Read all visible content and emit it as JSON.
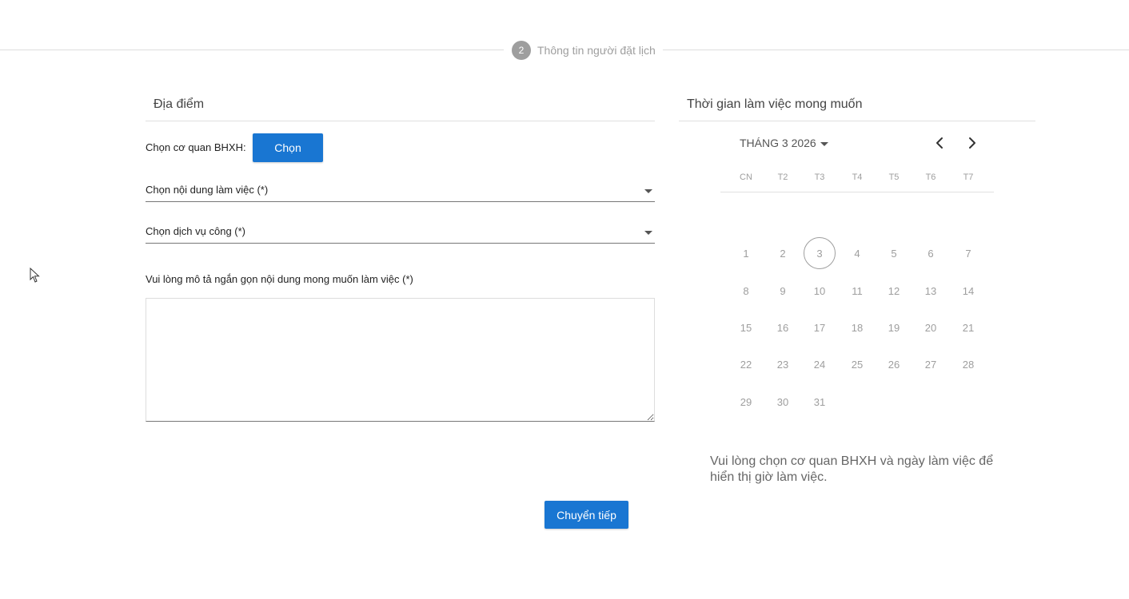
{
  "stepper": {
    "step_number": "2",
    "step_label": "Thông tin người đặt lịch"
  },
  "location": {
    "title": "Địa điểm",
    "agency_label": "Chọn cơ quan BHXH:",
    "choose_button": "Chọn",
    "work_content_select": "Chọn nội dung làm việc (*)",
    "public_service_select": "Chọn dịch vụ công (*)",
    "description_label": "Vui lòng mô tả ngắn gọn nội dung mong muốn làm việc (*)",
    "description_value": ""
  },
  "schedule": {
    "title": "Thời gian làm việc mong muốn",
    "month_label": "THÁNG 3 2026",
    "weekdays": [
      "CN",
      "T2",
      "T3",
      "T4",
      "T5",
      "T6",
      "T7"
    ],
    "days": [
      "1",
      "2",
      "3",
      "4",
      "5",
      "6",
      "7",
      "8",
      "9",
      "10",
      "11",
      "12",
      "13",
      "14",
      "15",
      "16",
      "17",
      "18",
      "19",
      "20",
      "21",
      "22",
      "23",
      "24",
      "25",
      "26",
      "27",
      "28",
      "29",
      "30",
      "31"
    ],
    "first_weekday_index": 0,
    "today": "3",
    "hint": "Vui lòng chọn cơ quan BHXH và ngày làm việc để hiển thị giờ làm việc."
  },
  "footer": {
    "next_button": "Chuyển tiếp"
  },
  "colors": {
    "primary": "#1976d2",
    "muted": "#9e9e9e"
  },
  "icons": {
    "prev": "chevron-left-icon",
    "next": "chevron-right-icon",
    "dropdown": "caret-down-icon",
    "cursor": "mouse-pointer-icon"
  }
}
